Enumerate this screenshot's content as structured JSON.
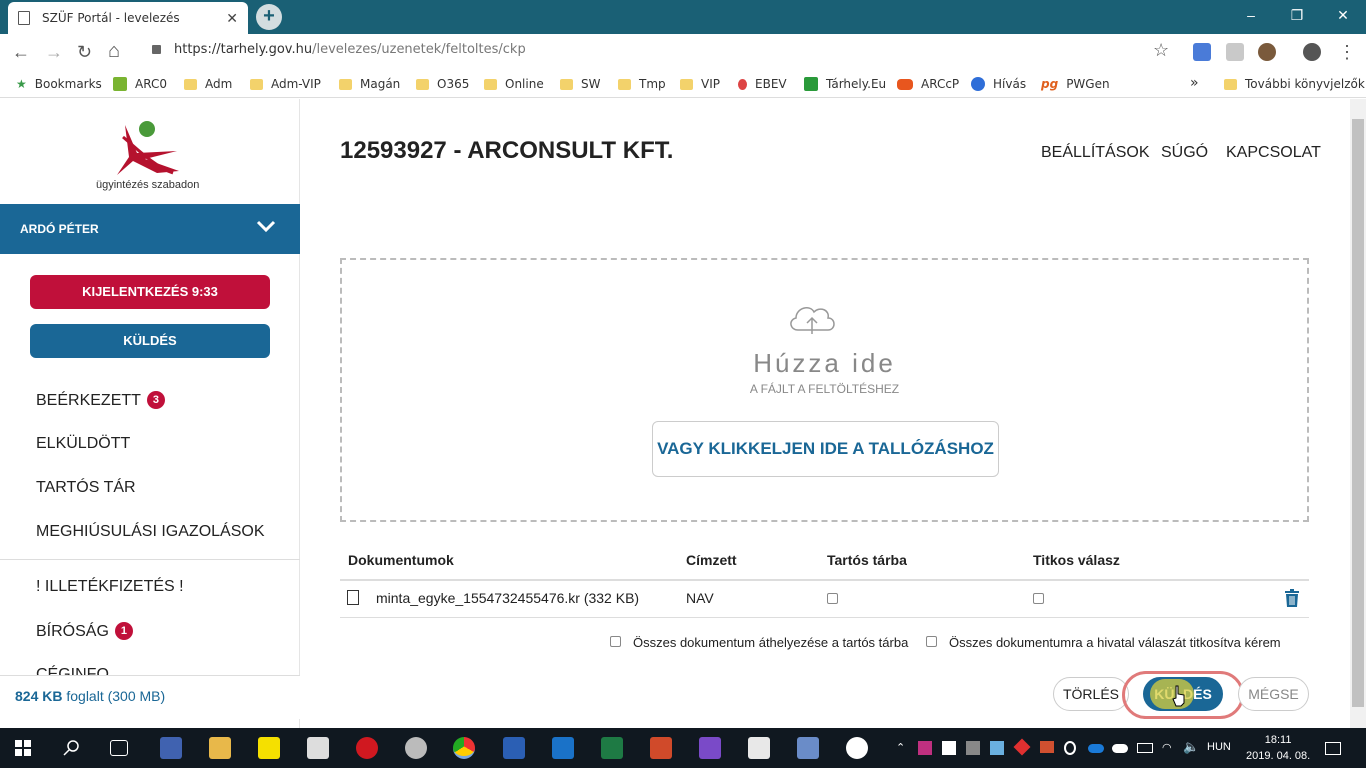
{
  "browser": {
    "tab_title": "SZÜF Portál - levelezés",
    "close": "✕",
    "new_tab": "+",
    "url_host": "https://tarhely.gov.hu",
    "url_path": "/levelezes/uzenetek/feltoltes/ckp",
    "win_min": "–",
    "win_max": "❐",
    "win_close": "✕",
    "back": "←",
    "forward": "→",
    "reload": "↻",
    "home": "⌂",
    "star": "☆",
    "menu": "⋮",
    "overflow": "»"
  },
  "bookmarks": [
    "Bookmarks",
    "ARC0",
    "Adm",
    "Adm-VIP",
    "Magán",
    "O365",
    "Online",
    "SW",
    "Tmp",
    "VIP",
    "EBEV",
    "Tárhely.Eu",
    "ARCcP",
    "Hívás",
    "PWGen"
  ],
  "other_bookmarks": "További könyvjelzők",
  "sidebar": {
    "logo_text": "ügyintézés szabadon",
    "user": "ARDÓ PÉTER",
    "logout": "KIJELENTKEZÉS 9:33",
    "send": "KÜLDÉS",
    "menu": [
      {
        "label": "BEÉRKEZETT",
        "badge": "3"
      },
      {
        "label": "ELKÜLDÖTT"
      },
      {
        "label": "TARTÓS TÁR"
      },
      {
        "label": "MEGHIÚSULÁSI IGAZOLÁSOK"
      },
      {
        "label": "! ILLETÉKFIZETÉS !"
      },
      {
        "label": "BÍRÓSÁG",
        "badge": "1"
      },
      {
        "label": "CÉGINFO"
      }
    ],
    "storage_used": "824 KB",
    "storage_rest": "foglalt (300 MB)"
  },
  "header": {
    "title": "12593927 - ARCONSULT KFT.",
    "nav": [
      "BEÁLLÍTÁSOK",
      "SÚGÓ",
      "KAPCSOLAT"
    ]
  },
  "dropzone": {
    "big": "Húzza ide",
    "small": "A FÁJLT A FELTÖLTÉSHEZ",
    "browse": "VAGY KLIKKELJEN IDE A TALLÓZÁSHOZ"
  },
  "table": {
    "headers": [
      "Dokumentumok",
      "Címzett",
      "Tartós tárba",
      "Titkos válasz"
    ],
    "rows": [
      {
        "doc": "minta_egyke_1554732455476.kr (332 KB)",
        "recipient": "NAV"
      }
    ]
  },
  "options": {
    "move_all": "Összes dokumentum áthelyezése a tartós tárba",
    "encrypt_all": "Összes dokumentumra a hivatal válaszát titkosítva kérem"
  },
  "actions": {
    "delete": "TÖRLÉS",
    "send": "KÜLDÉS",
    "cancel": "MÉGSE"
  },
  "taskbar": {
    "lang": "HUN",
    "time": "18:11",
    "date": "2019. 04. 08."
  }
}
